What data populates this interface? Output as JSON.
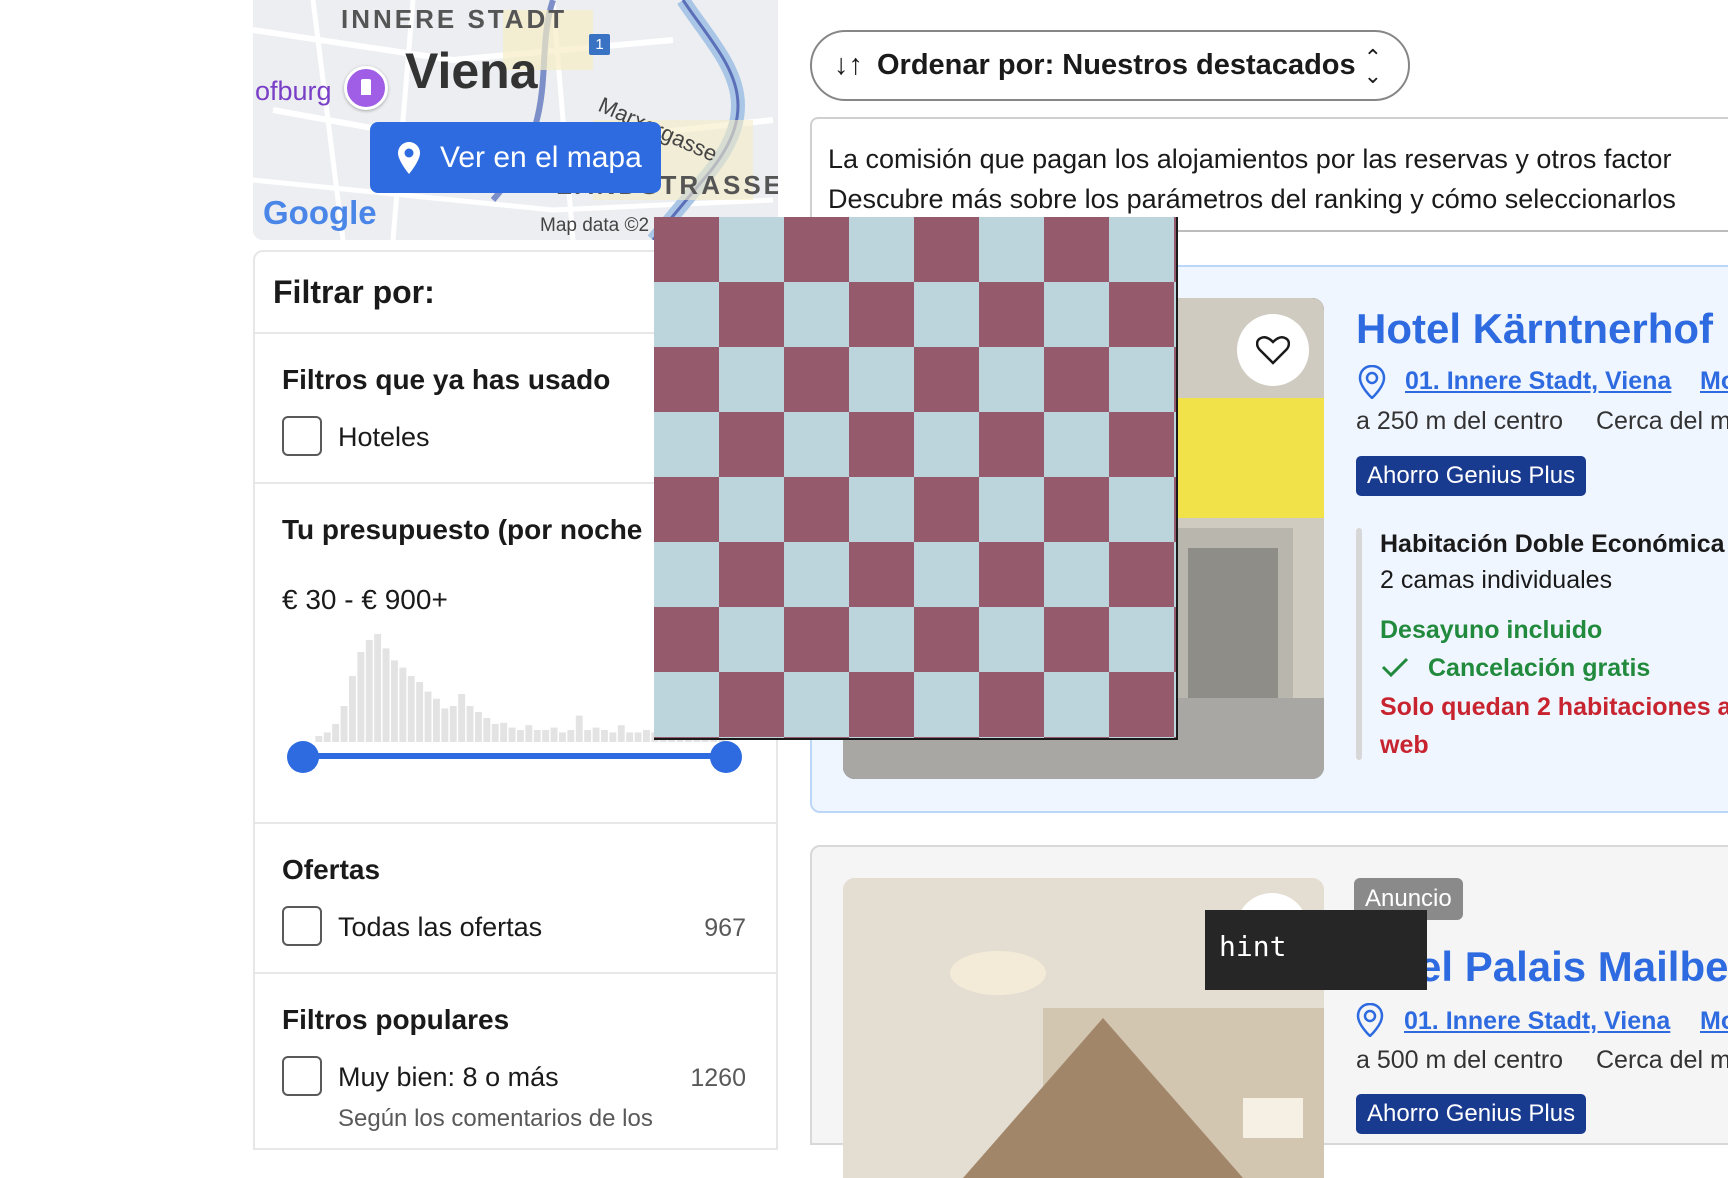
{
  "map": {
    "district": "INNERE STADT",
    "city": "Viena",
    "poi": "ofburg",
    "street": "Marxergasse",
    "district2": "LANDSTRASSE",
    "route_number": "1",
    "google": "Google",
    "map_data": "Map data ©2",
    "button_label": "Ver en el mapa"
  },
  "filters": {
    "title": "Filtrar por:",
    "used_title": "Filtros que ya has usado",
    "used_items": [
      {
        "label": "Hoteles"
      }
    ],
    "budget_title": "Tu presupuesto (por noche",
    "budget_value": "€ 30 - € 900+",
    "budget_histogram": [
      0,
      0.05,
      0.08,
      0.15,
      0.3,
      0.55,
      0.75,
      0.85,
      0.9,
      0.78,
      0.68,
      0.62,
      0.55,
      0.5,
      0.42,
      0.36,
      0.28,
      0.3,
      0.4,
      0.3,
      0.25,
      0.2,
      0.15,
      0.16,
      0.12,
      0.1,
      0.14,
      0.1,
      0.1,
      0.12,
      0.08,
      0.1,
      0.22,
      0.1,
      0.12,
      0.1,
      0.08,
      0.14,
      0.08,
      0.08,
      0.1,
      0.08,
      0.06,
      0.08,
      0.06,
      0.05,
      0.06,
      0.05,
      0.05,
      0.04
    ],
    "offers_title": "Ofertas",
    "offers_items": [
      {
        "label": "Todas las ofertas",
        "count": "967"
      }
    ],
    "popular_title": "Filtros populares",
    "popular_items": [
      {
        "label": "Muy bien: 8 o más",
        "count": "1260",
        "sub": "Según los comentarios de los"
      }
    ]
  },
  "sort": {
    "label": "Ordenar por: Nuestros destacados"
  },
  "notice": {
    "line1": "La comisión que pagan los alojamientos por las reservas y otros factor",
    "line2": "Descubre más sobre los parámetros del ranking y cómo seleccionarlos"
  },
  "listings": [
    {
      "title": "Hotel Kärntnerhof",
      "location": "01. Innere Stadt, Viena",
      "location_extra": "Mo",
      "distance": "a 250 m del centro",
      "nearby": "Cerca del m",
      "badge": "Ahorro Genius Plus",
      "room": "Habitación Doble Económica",
      "beds": "2 camas individuales",
      "breakfast": "Desayuno incluido",
      "cancellation": "Cancelación gratis",
      "scarcity": "Solo quedan 2 habitaciones a web"
    },
    {
      "ad_label": "Anuncio",
      "title": "el Palais Mailbe",
      "location": "01. Innere Stadt, Viena",
      "location_extra": "Mo",
      "distance": "a 500 m del centro",
      "nearby": "Cerca del m",
      "badge": "Ahorro Genius Plus"
    }
  ],
  "tooltip": {
    "text": "hint"
  },
  "colors": {
    "primary": "#2e6be0",
    "genius": "#183a8f",
    "success": "#218a3c",
    "danger": "#c8242f",
    "checker_a": "#955b6c",
    "checker_b": "#bcd4dc"
  },
  "icons": [
    "map-pin-icon",
    "heart-icon",
    "sort-icon",
    "chevron-updown-icon",
    "checkmark-icon",
    "location-badge-icon"
  ]
}
